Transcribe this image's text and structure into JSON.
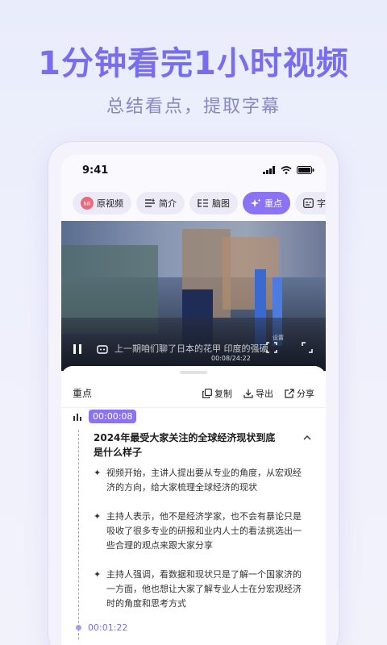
{
  "hero": {
    "title": "1分钟看完1小时视频",
    "subtitle": "总结看点，提取字幕"
  },
  "status_bar": {
    "time": "9:41"
  },
  "tabs": [
    {
      "label": "原视频",
      "icon": "original-video-icon",
      "active": false
    },
    {
      "label": "简介",
      "icon": "summary-list-icon",
      "active": false
    },
    {
      "label": "脑图",
      "icon": "mindmap-icon",
      "active": false
    },
    {
      "label": "重点",
      "icon": "sparkle-icon",
      "active": true
    },
    {
      "label": "字幕",
      "icon": "subtitle-icon",
      "active": false
    }
  ],
  "video": {
    "subtitle_text": "上一期咱们聊了日本的花甲 印度的强硬",
    "time_display": "00:08/24:22",
    "corner_tag": "设置"
  },
  "panel": {
    "title": "重点",
    "actions": [
      {
        "label": "复制",
        "icon": "copy-icon"
      },
      {
        "label": "导出",
        "icon": "export-icon"
      },
      {
        "label": "分享",
        "icon": "share-icon"
      }
    ]
  },
  "highlights": [
    {
      "timestamp": "00:00:08",
      "title": "2024年最受大家关注的全球经济现状到底是什么样子",
      "points": [
        "视频开始，主讲人提出要从专业的角度，从宏观经济的方向，给大家梳理全球经济的现状",
        "主持人表示，他不是经济学家，也不会有暴论只是吸收了很多专业的研报和业内人士的看法挑选出一些合理的观点来跟大家分享",
        "主持人强调，看数据和现状只是了解一个国家济的一方面，他也想让大家了解专业人士在分宏观经济时的角度和思考方式"
      ]
    },
    {
      "timestamp": "00:01:22"
    }
  ],
  "colors": {
    "accent": "#8b73f5",
    "hero_title": "#7a6cf0",
    "hero_subtitle": "#8a86c8"
  }
}
